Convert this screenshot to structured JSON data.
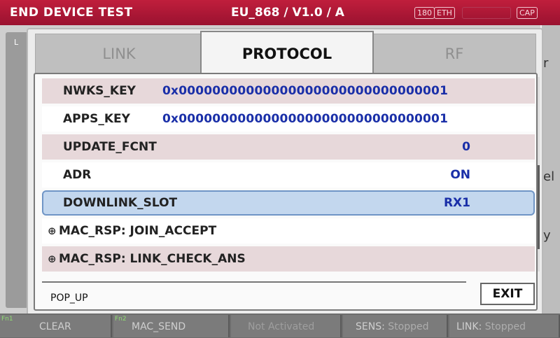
{
  "header": {
    "title": "END DEVICE TEST",
    "mode": "EU_868 / V1.0 / A",
    "badges": [
      "180",
      "ETH",
      "CAP"
    ]
  },
  "background": {
    "left_label": "L",
    "right_fragments": [
      "r",
      "el",
      "y"
    ]
  },
  "tabs": [
    {
      "label": "LINK",
      "active": false
    },
    {
      "label": "PROTOCOL",
      "active": true
    },
    {
      "label": "RF",
      "active": false
    }
  ],
  "rows": [
    {
      "label": "NWKS_KEY",
      "value": "0x00000000000000000000000000000001"
    },
    {
      "label": "APPS_KEY",
      "value": "0x00000000000000000000000000000001"
    },
    {
      "label": "UPDATE_FCNT",
      "value": "0"
    },
    {
      "label": "ADR",
      "value": "ON"
    },
    {
      "label": "DOWNLINK_SLOT",
      "value": "RX1"
    },
    {
      "label": "MAC_RSP: JOIN_ACCEPT",
      "expand_symbol": "⊕"
    },
    {
      "label": "MAC_RSP: LINK_CHECK_ANS",
      "expand_symbol": "⊕"
    }
  ],
  "popup": {
    "label": "POP_UP",
    "exit_label": "EXIT"
  },
  "function_keys": [
    {
      "num": "Fn1",
      "label": "CLEAR"
    },
    {
      "num": "Fn2",
      "label": "MAC_SEND"
    },
    {
      "label": "Not Activated"
    },
    {
      "label": "SENS:",
      "status": "Stopped"
    },
    {
      "label": "LINK:",
      "status": "Stopped"
    }
  ],
  "colors": {
    "header_bg": "#b0183a",
    "value_blue": "#1a2fa8",
    "alt_row": "#e7d8da",
    "selected_row": "#c3d7ee",
    "fn_number": "#8fdc73"
  }
}
